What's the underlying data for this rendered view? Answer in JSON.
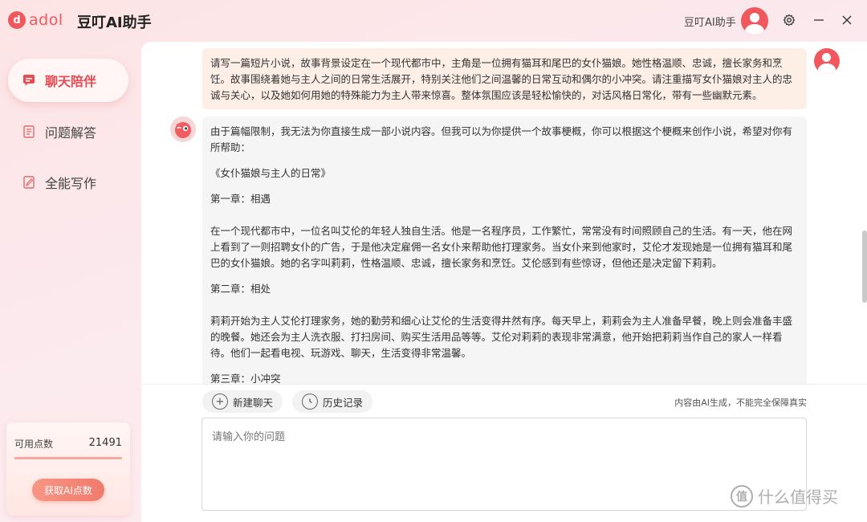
{
  "titlebar": {
    "logo_mark": "d",
    "logo_text": "adol",
    "app_title": "豆叮AI助手",
    "user_name": "豆叮AI助手",
    "settings_icon": "gear-icon",
    "minimize_icon": "minimize-icon",
    "close_icon": "close-icon"
  },
  "sidebar": {
    "items": [
      {
        "label": "聊天陪伴",
        "icon": "chat-bubble-icon",
        "active": true
      },
      {
        "label": "问题解答",
        "icon": "document-list-icon",
        "active": false
      },
      {
        "label": "全能写作",
        "icon": "edit-document-icon",
        "active": false
      }
    ],
    "points": {
      "label": "可用点数",
      "value": "21491",
      "button": "获取AI点数"
    }
  },
  "chat": {
    "user_message": "请写一篇短片小说，故事背景设定在一个现代都市中，主角是一位拥有猫耳和尾巴的女仆猫娘。她性格温顺、忠诚，擅长家务和烹饪。故事围绕着她与主人之间的日常生活展开，特别关注他们之间温馨的日常互动和偶尔的小冲突。请注重描写女仆猫娘对主人的忠诚与关心，以及她如何用她的特殊能力为主人带来惊喜。整体氛围应该是轻松愉快的，对话风格日常化，带有一些幽默元素。",
    "bot_paragraphs": [
      "由于篇幅限制，我无法为你直接生成一部小说内容。但我可以为你提供一个故事梗概，你可以根据这个梗概来创作小说，希望对你有所帮助：",
      "《女仆猫娘与主人的日常》",
      "第一章：相遇",
      "在一个现代都市中，一位名叫艾伦的年轻人独自生活。他是一名程序员，工作繁忙，常常没有时间照顾自己的生活。有一天，他在网上看到了一则招聘女仆的广告，于是他决定雇佣一名女仆来帮助他打理家务。当女仆来到他家时，艾伦才发现她是一位拥有猫耳和尾巴的女仆猫娘。她的名字叫莉莉，性格温顺、忠诚，擅长家务和烹饪。艾伦感到有些惊讶，但他还是决定留下莉莉。",
      "第二章：相处",
      "莉莉开始为主人艾伦打理家务，她的勤劳和细心让艾伦的生活变得井然有序。每天早上，莉莉会为主人准备早餐，晚上则会准备丰盛的晚餐。她还会为主人洗衣服、打扫房间、购买生活用品等等。艾伦对莉莉的表现非常满意，他开始把莉莉当作自己的家人一样看待。他们一起看电视、玩游戏、聊天，生活变得非常温馨。",
      "第三章：小冲突"
    ]
  },
  "actions": {
    "new_chat": "新建聊天",
    "history": "历史记录",
    "disclaimer": "内容由AI生成，不能完全保障真实"
  },
  "input": {
    "placeholder": "请输入你的问题"
  },
  "watermark": {
    "mark": "值",
    "text": "什么值得买"
  }
}
